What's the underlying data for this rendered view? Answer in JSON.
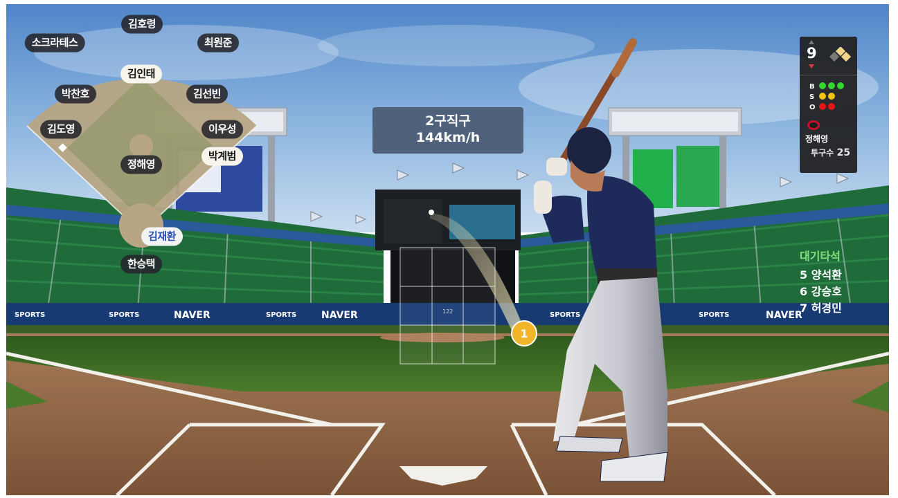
{
  "pitch_info": {
    "type": "2구직구",
    "speed": "144km/h",
    "pitch_marker": "1"
  },
  "fielders": [
    {
      "id": "lf",
      "name": "소크라테스"
    },
    {
      "id": "cf",
      "name": "김호령"
    },
    {
      "id": "rf",
      "name": "최원준"
    },
    {
      "id": "2b",
      "name": "김선빈"
    },
    {
      "id": "ss",
      "name": "박찬호"
    },
    {
      "id": "3b",
      "name": "김도영"
    },
    {
      "id": "1b",
      "name": "이우성"
    },
    {
      "id": "p",
      "name": "정해영"
    },
    {
      "id": "c",
      "name": "한승택"
    }
  ],
  "runners": [
    {
      "base": "second",
      "name": "김인태"
    },
    {
      "base": "first",
      "name": "박계범"
    }
  ],
  "batter": {
    "name": "김재환"
  },
  "scoreboard": {
    "inning": "9",
    "counts": {
      "ball_label": "B",
      "strike_label": "S",
      "out_label": "O",
      "balls": 3,
      "strikes": 2,
      "outs": 2
    },
    "colors": {
      "ball": "#35d62f",
      "strike": "#f2c313",
      "out": "#e41616"
    },
    "pitcher_team_logo": "tigers-logo-icon",
    "pitcher_name": "정해영",
    "pitch_count_label": "투구수",
    "pitch_count": "25"
  },
  "waiting": {
    "title": "대기타석",
    "batters": [
      "5 양석환",
      "6 강승호",
      "7 허경민"
    ]
  },
  "stadium_ads": {
    "naver": "NAVER",
    "naver_sports": "SPORTS",
    "scoreboard_number": "122"
  }
}
